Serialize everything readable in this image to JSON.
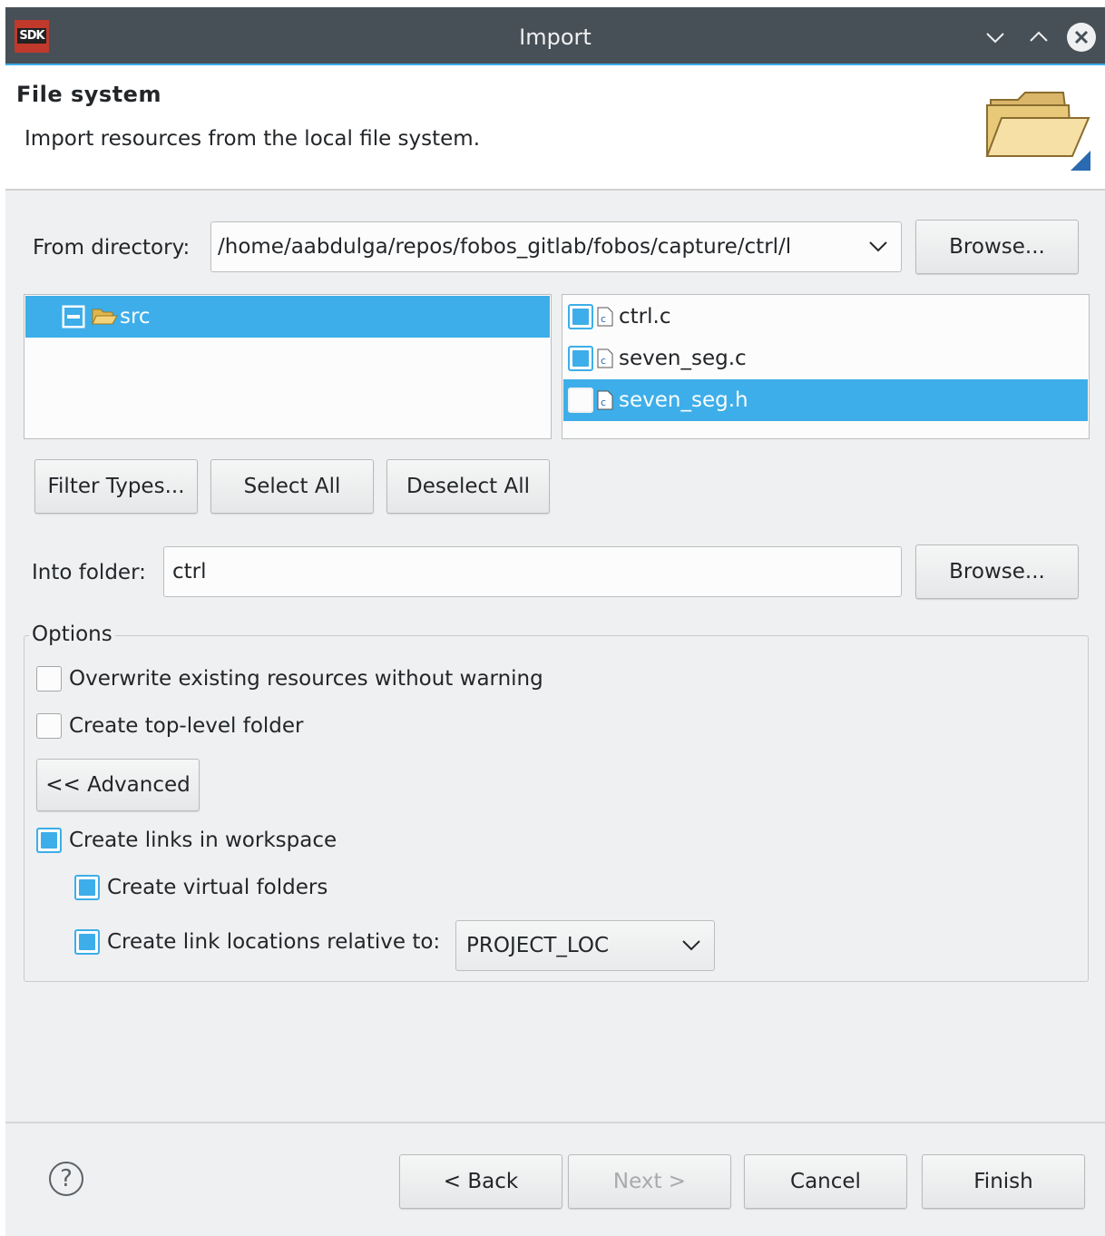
{
  "window": {
    "title": "Import",
    "logo_text": "SDK",
    "controls": [
      "chevron-down-icon",
      "chevron-up-icon",
      "close-icon"
    ]
  },
  "header": {
    "title": "File system",
    "description": "Import resources from the local file system."
  },
  "from_directory": {
    "label": "From directory:",
    "value": "/home/aabdulga/repos/fobos_gitlab/fobos/capture/ctrl/l",
    "browse_label": "Browse..."
  },
  "folder_tree": {
    "items": [
      {
        "label": "src",
        "selected": true
      }
    ]
  },
  "file_list": {
    "items": [
      {
        "label": "ctrl.c",
        "checked": true,
        "selected": false
      },
      {
        "label": "seven_seg.c",
        "checked": true,
        "selected": false
      },
      {
        "label": "seven_seg.h",
        "checked": false,
        "selected": true
      }
    ]
  },
  "selection_buttons": {
    "filter_types": "Filter Types...",
    "select_all": "Select All",
    "deselect_all": "Deselect All"
  },
  "into_folder": {
    "label": "Into folder:",
    "value": "ctrl",
    "browse_label": "Browse..."
  },
  "options": {
    "group_label": "Options",
    "overwrite": {
      "label": "Overwrite existing resources without warning",
      "checked": false
    },
    "top_level": {
      "label": "Create top-level folder",
      "checked": false
    },
    "advanced_button": "<< Advanced",
    "create_links": {
      "label": "Create links in workspace",
      "checked": true
    },
    "virtual_folders": {
      "label": "Create virtual folders",
      "checked": true
    },
    "relative_to": {
      "label": "Create link locations relative to:",
      "checked": true,
      "value": "PROJECT_LOC"
    }
  },
  "footer": {
    "help_symbol": "?",
    "back": "< Back",
    "next": "Next >",
    "cancel": "Cancel",
    "finish": "Finish"
  },
  "colors": {
    "accent": "#3daee9",
    "titlebar": "#475057",
    "background": "#eff0f1"
  }
}
